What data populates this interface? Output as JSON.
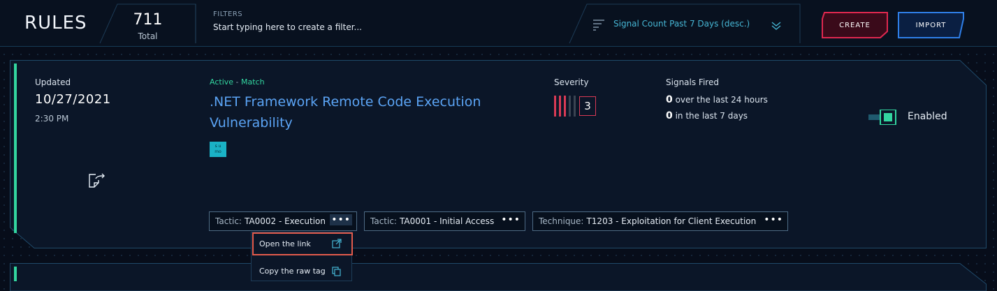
{
  "header": {
    "title": "RULES",
    "total_count": "711",
    "total_label": "Total",
    "filters_label": "FILTERS",
    "filter_placeholder": "Start typing here to create a filter...",
    "sort_label": "Signal Count Past 7 Days (desc.)",
    "create_label": "CREATE",
    "import_label": "IMPORT"
  },
  "rule": {
    "updated_label": "Updated",
    "updated_date": "10/27/2021",
    "updated_time": "2:30 PM",
    "status_active": "Active",
    "status_sep": " - ",
    "status_match": "Match",
    "title": ".NET Framework Remote Code Execution Vulnerability",
    "source_badge_top": "s u",
    "source_badge_bottom": "mo",
    "severity_label": "Severity",
    "severity_value": "3",
    "severity_level": 3,
    "severity_max": 5,
    "signals_label": "Signals Fired",
    "signals_24h_count": "0",
    "signals_24h_text": " over the last 24 hours",
    "signals_7d_count": "0",
    "signals_7d_text": " in the last 7 days",
    "enabled_label": "Enabled",
    "enabled": true,
    "tags": [
      {
        "prefix": "Tactic:",
        "value": "TA0002 - Execution"
      },
      {
        "prefix": "Tactic:",
        "value": "TA0001 - Initial Access"
      },
      {
        "prefix": "Technique:",
        "value": "T1203 - Exploitation for Client Execution"
      }
    ]
  },
  "tag_menu": {
    "items": [
      {
        "label": "Open the link",
        "icon": "external-link-icon"
      },
      {
        "label": "Copy the raw tag",
        "icon": "copy-icon"
      }
    ]
  },
  "colors": {
    "accent_green": "#33d6a0",
    "link_blue": "#5ba4f5",
    "create_red": "#e0284f",
    "import_blue": "#2f7fe8",
    "severity_red": "#d83a55",
    "highlight": "#e35b4c"
  }
}
